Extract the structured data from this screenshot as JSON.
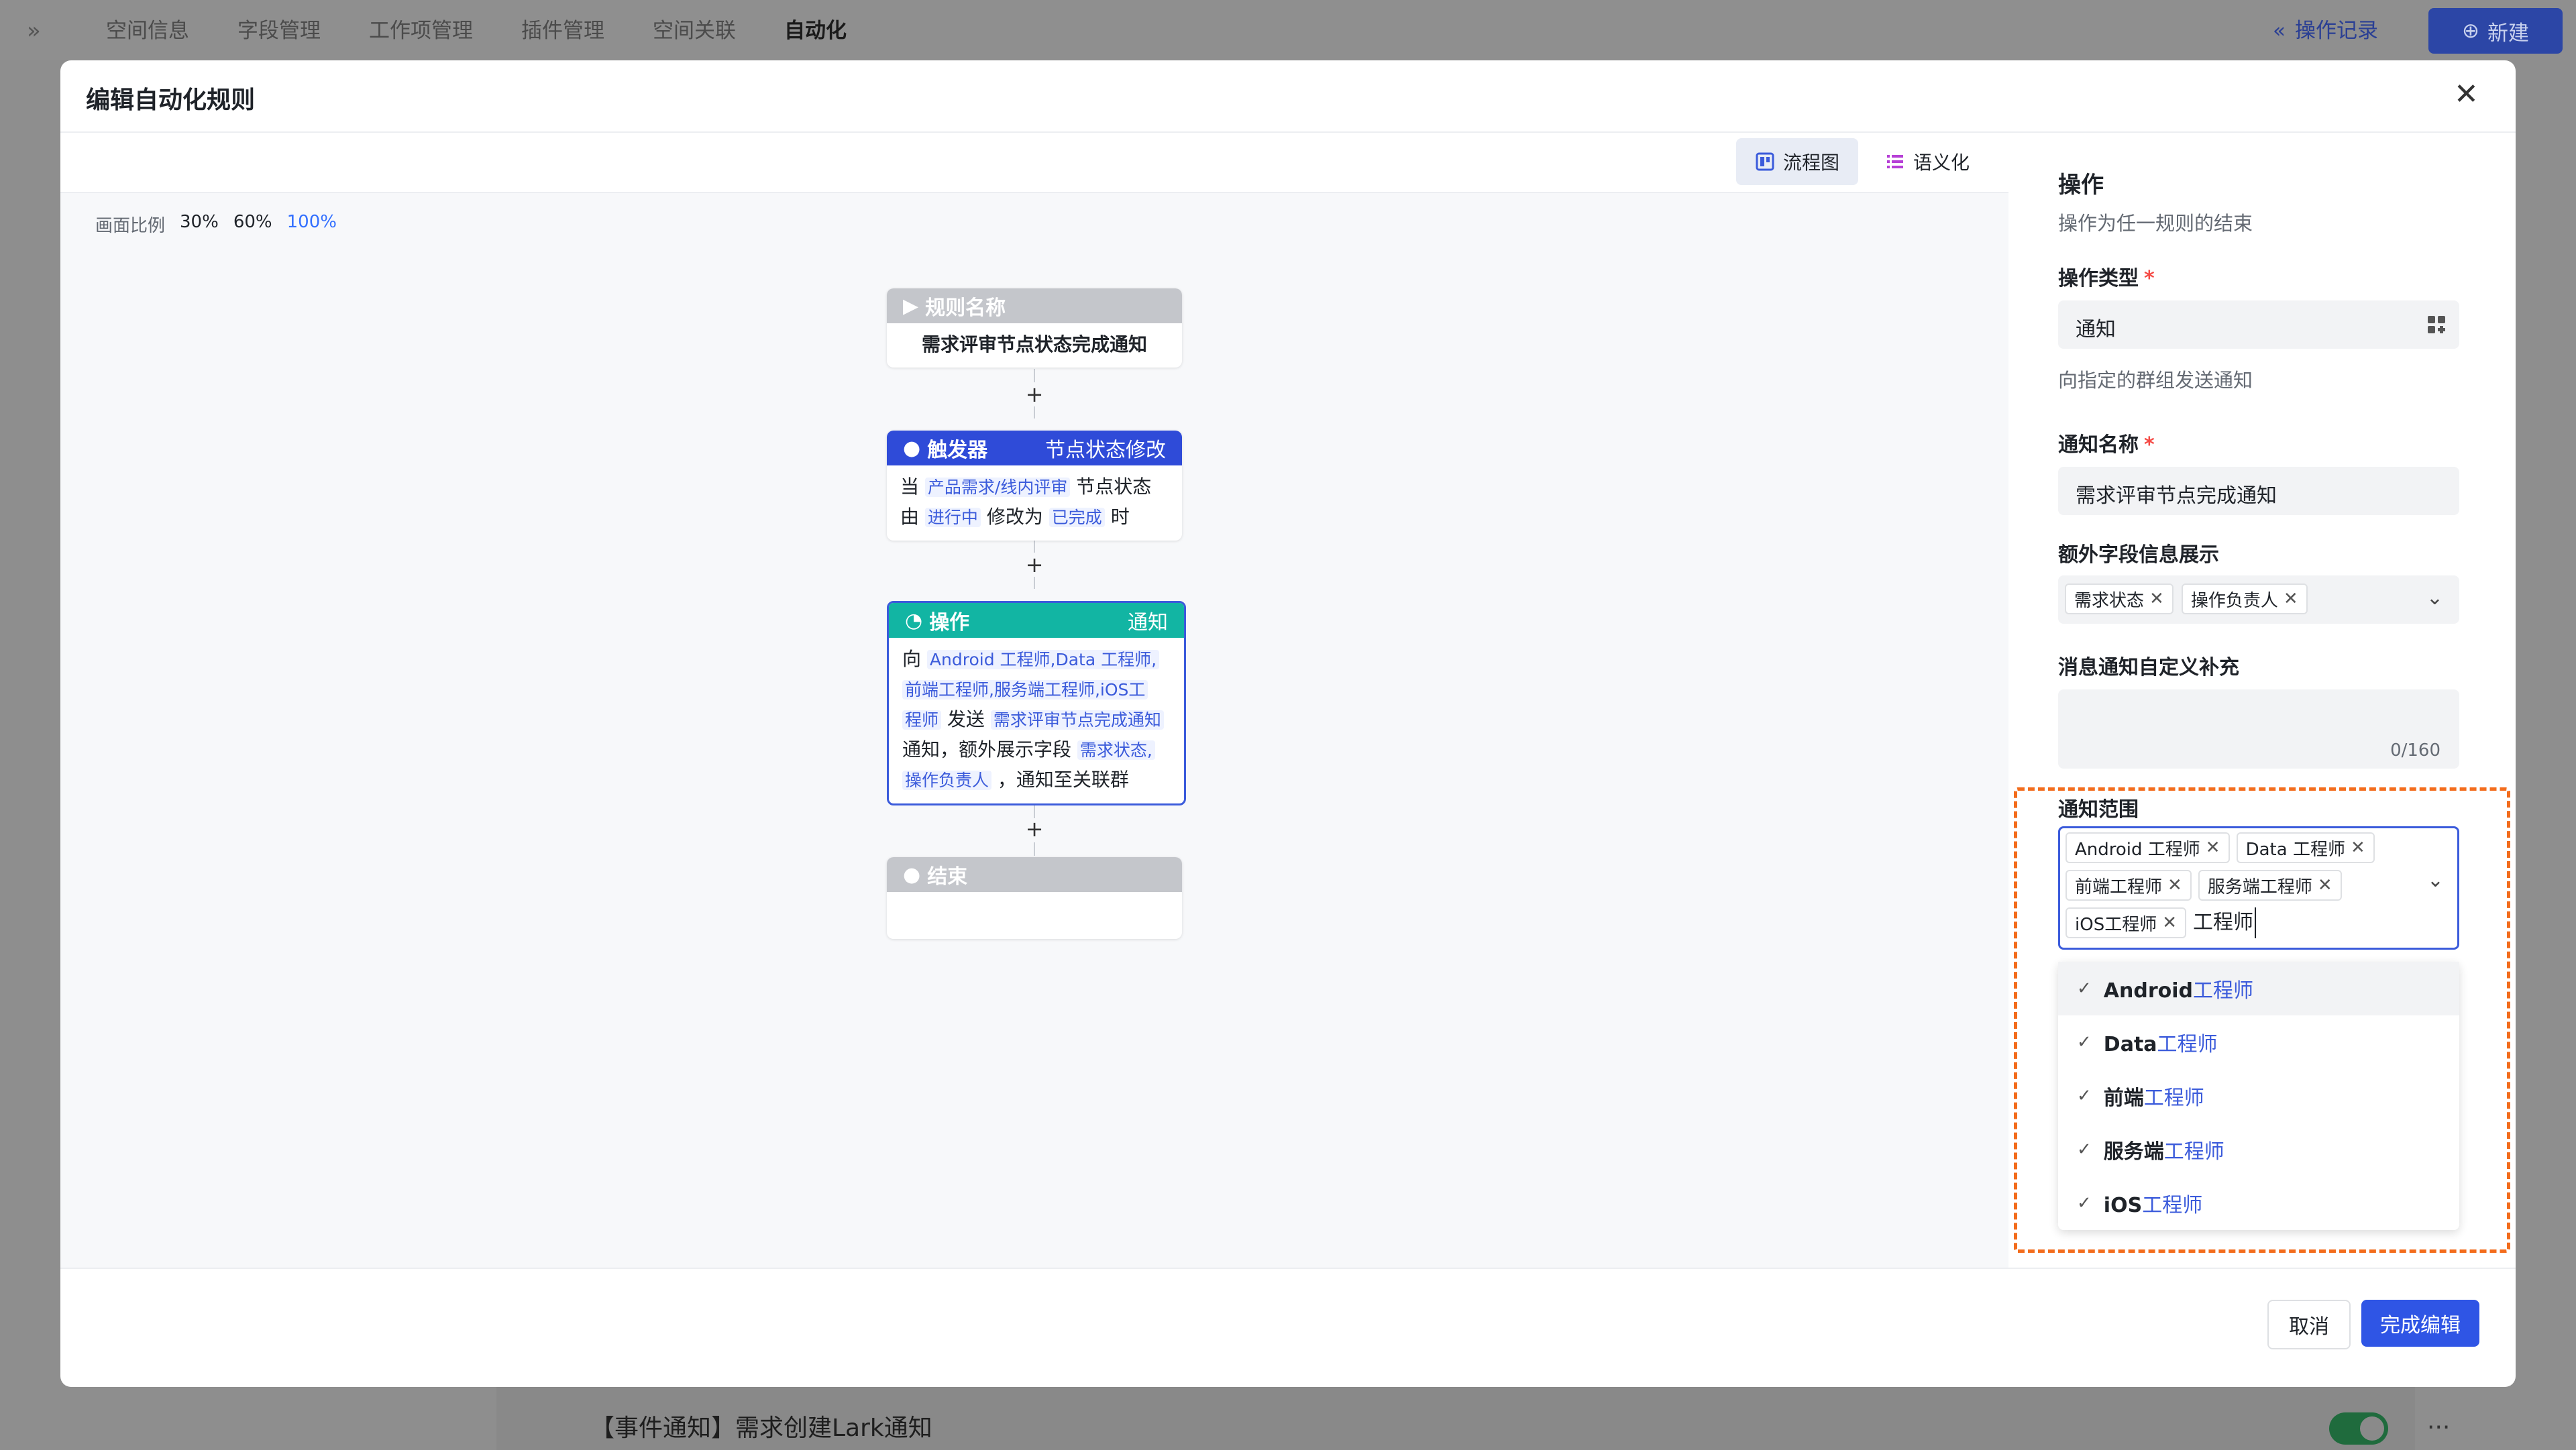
{
  "nav": {
    "items": [
      "空间信息",
      "字段管理",
      "工作项管理",
      "插件管理",
      "空间关联",
      "自动化"
    ],
    "active_index": 5,
    "op_log": "操作记录",
    "new_button": "新建"
  },
  "background_row": {
    "title": "【事件通知】需求创建Lark通知"
  },
  "modal": {
    "title": "编辑自动化规则",
    "views": {
      "flow": "流程图",
      "semantic": "语义化"
    },
    "scale": {
      "label": "画面比例",
      "options": [
        "30%",
        "60%",
        "100%"
      ],
      "selected": "100%"
    },
    "nodes": {
      "rule_name": {
        "header": "规则名称",
        "body": "需求评审节点状态完成通知"
      },
      "trigger": {
        "header": "触发器",
        "tag": "节点状态修改",
        "t1": "当",
        "p1": "产品需求/线内评审",
        "t2": "节点状态",
        "t3": "由",
        "p2": "进行中",
        "t4": "修改为",
        "p3": "已完成",
        "t5": "时"
      },
      "action": {
        "header": "操作",
        "tag": "通知",
        "t1": "向",
        "p1a": "Android 工程师,Data 工程师,",
        "p1b": "前端工程师,服务端工程师,iOS工",
        "p1c": "程师",
        "t2": "发送",
        "p2": "需求评审节点完成通知",
        "t3": "通知，额外展示字段",
        "p3a": "需求状态,",
        "p3b": "操作负责人",
        "t4": "，通知至关联群"
      },
      "end": {
        "header": "结束"
      }
    },
    "footer": {
      "cancel": "取消",
      "done": "完成编辑"
    }
  },
  "panel": {
    "title": "操作",
    "subtitle": "操作为任一规则的结束",
    "op_type": {
      "label": "操作类型",
      "value": "通知",
      "hint": "向指定的群组发送通知"
    },
    "notify_name": {
      "label": "通知名称",
      "value": "需求评审节点完成通知"
    },
    "extra_fields": {
      "label": "额外字段信息展示",
      "tags": [
        "需求状态",
        "操作负责人"
      ]
    },
    "custom_msg": {
      "label": "消息通知自定义补充",
      "counter": "0/160"
    },
    "scope": {
      "label": "通知范围",
      "tags": [
        "Android 工程师",
        "Data 工程师",
        "前端工程师",
        "服务端工程师",
        "iOS工程师"
      ],
      "search": "工程师",
      "options": [
        {
          "prefix": "Android",
          "match": "工程师"
        },
        {
          "prefix": "Data",
          "match": "工程师"
        },
        {
          "prefix": "前端",
          "match": "工程师"
        },
        {
          "prefix": "服务端",
          "match": "工程师"
        },
        {
          "prefix": "iOS",
          "match": "工程师"
        }
      ]
    }
  },
  "colors": {
    "trigger": "#2f4bd8",
    "action": "#12b5a3",
    "gray": "#c4c6cb",
    "primary": "#2f55e5",
    "highlight_border": "#f36c1c"
  }
}
